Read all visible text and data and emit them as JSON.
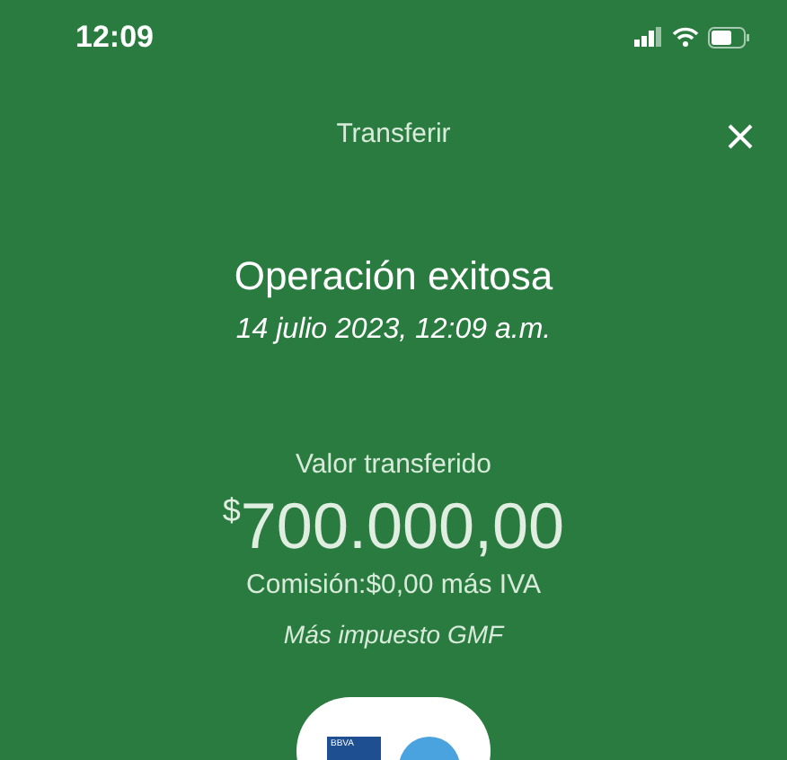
{
  "status_bar": {
    "time": "12:09"
  },
  "header": {
    "title": "Transferir"
  },
  "result": {
    "title": "Operación exitosa",
    "date": "14 julio 2023, 12:09 a.m."
  },
  "transfer": {
    "label": "Valor transferido",
    "currency": "$",
    "amount": "700.000,00",
    "fee": "Comisión:$0,00 más IVA",
    "tax_note": "Más impuesto GMF"
  },
  "bank_card": {
    "logo_text": "BBVA"
  }
}
